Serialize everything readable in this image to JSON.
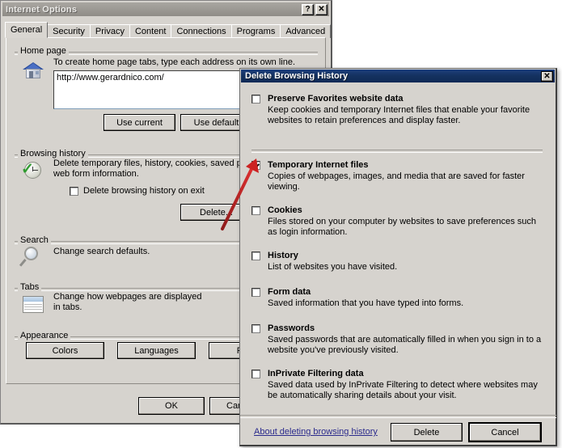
{
  "internet_options": {
    "title": "Internet Options",
    "help_button": "?",
    "close_button": "✕",
    "tabs": [
      {
        "label": "General",
        "active": true
      },
      {
        "label": "Security",
        "active": false
      },
      {
        "label": "Privacy",
        "active": false
      },
      {
        "label": "Content",
        "active": false
      },
      {
        "label": "Connections",
        "active": false
      },
      {
        "label": "Programs",
        "active": false
      },
      {
        "label": "Advanced",
        "active": false
      }
    ],
    "home_page": {
      "group_label": "Home page",
      "icon": "house-icon",
      "description": "To create home page tabs, type each address on its own line.",
      "url_value": "http://www.gerardnico.com/",
      "use_current_label": "Use current",
      "use_default_label": "Use default"
    },
    "browsing_history": {
      "group_label": "Browsing history",
      "icon": "clock-check-icon",
      "description": "Delete temporary files, history, cookies, saved passwords, and web form information.",
      "checkbox_label": "Delete browsing history on exit",
      "checkbox_checked": false,
      "delete_button": "Delete..."
    },
    "search": {
      "group_label": "Search",
      "icon": "magnifier-icon",
      "description": "Change search defaults."
    },
    "tabs_section": {
      "group_label": "Tabs",
      "icon": "tabs-icon",
      "description": "Change how webpages are displayed in tabs."
    },
    "appearance": {
      "group_label": "Appearance",
      "colors_button": "Colors",
      "languages_button": "Languages",
      "fonts_button": "Fonts"
    },
    "footer": {
      "ok_button": "OK",
      "cancel_button": "Cancel"
    }
  },
  "delete_browsing_history": {
    "title": "Delete Browsing History",
    "close_button": "✕",
    "items": [
      {
        "name": "preserve-favorites",
        "title": "Preserve Favorites website data",
        "description": "Keep cookies and temporary Internet files that enable your favorite websites to retain preferences and display faster.",
        "checked": false
      },
      {
        "name": "temporary-internet-files",
        "title": "Temporary Internet files",
        "description": "Copies of webpages, images, and media that are saved for faster viewing.",
        "checked": true
      },
      {
        "name": "cookies",
        "title": "Cookies",
        "description": "Files stored on your computer by websites to save preferences such as login information.",
        "checked": false
      },
      {
        "name": "history",
        "title": "History",
        "description": "List of websites you have visited.",
        "checked": false
      },
      {
        "name": "form-data",
        "title": "Form data",
        "description": "Saved information that you have typed into forms.",
        "checked": false
      },
      {
        "name": "passwords",
        "title": "Passwords",
        "description": "Saved passwords that are automatically filled in when you sign in to a website you've previously visited.",
        "checked": false
      },
      {
        "name": "inprivate-filtering-data",
        "title": "InPrivate Filtering data",
        "description": "Saved data used by InPrivate Filtering to detect where websites may be automatically sharing details about your visit.",
        "checked": false
      }
    ],
    "about_link": "About deleting browsing history",
    "delete_button": "Delete",
    "cancel_button": "Cancel"
  },
  "annotation": {
    "arrow_color": "#cc2222",
    "arrow_name": "red-pointer-arrow"
  }
}
